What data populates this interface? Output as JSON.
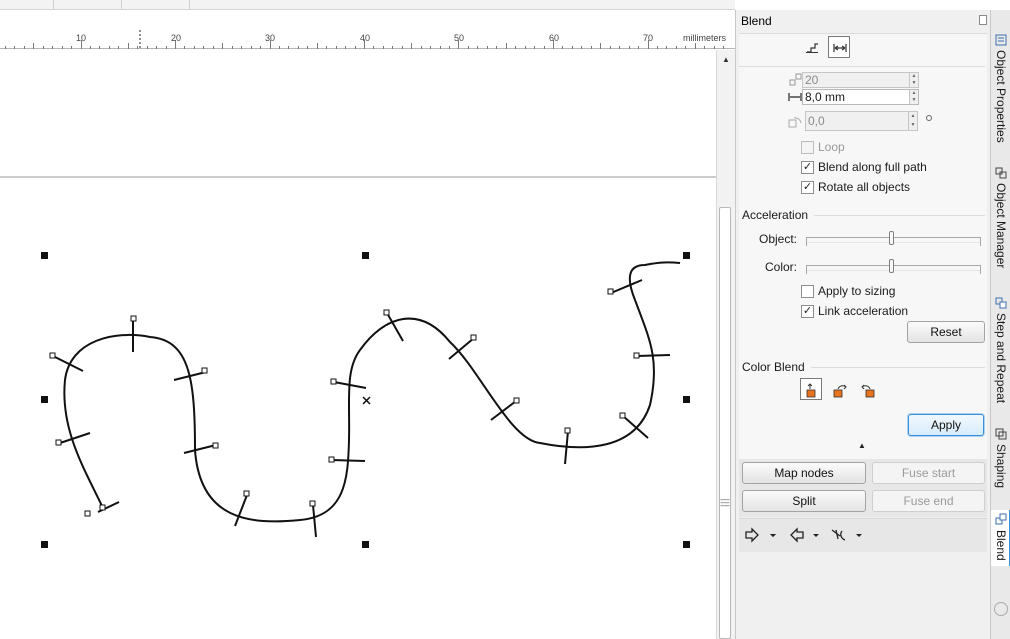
{
  "ruler": {
    "labels": [
      "10",
      "20",
      "30",
      "40",
      "50",
      "60",
      "70"
    ],
    "unit": "millimeters"
  },
  "docker": {
    "title": "Blend",
    "steps_value": "20",
    "spacing_value": "8,0 mm",
    "rotation_value": "0,0",
    "loop_label": "Loop",
    "loop_checked": false,
    "blend_full_path_label": "Blend along full path",
    "blend_full_path_checked": true,
    "rotate_all_label": "Rotate all objects",
    "rotate_all_checked": true,
    "acceleration_title": "Acceleration",
    "object_label": "Object:",
    "object_accel": 0.49,
    "color_label": "Color:",
    "color_accel": 0.49,
    "apply_sizing_label": "Apply to sizing",
    "apply_sizing_checked": false,
    "link_accel_label": "Link acceleration",
    "link_accel_checked": true,
    "reset_label": "Reset",
    "color_blend_title": "Color Blend",
    "apply_label": "Apply",
    "map_nodes_label": "Map nodes",
    "fuse_start_label": "Fuse start",
    "split_label": "Split",
    "fuse_end_label": "Fuse end"
  },
  "tabs": [
    {
      "label": "Object Properties",
      "icon": "properties-icon"
    },
    {
      "label": "Object Manager",
      "icon": "object-manager-icon"
    },
    {
      "label": "Step and Repeat",
      "icon": "step-repeat-icon"
    },
    {
      "label": "Shaping",
      "icon": "shaping-icon"
    },
    {
      "label": "Blend",
      "icon": "blend-icon",
      "active": true
    }
  ],
  "colors": {
    "accent": "#3d8ed8",
    "color_blend_orange": "#e8731e"
  }
}
